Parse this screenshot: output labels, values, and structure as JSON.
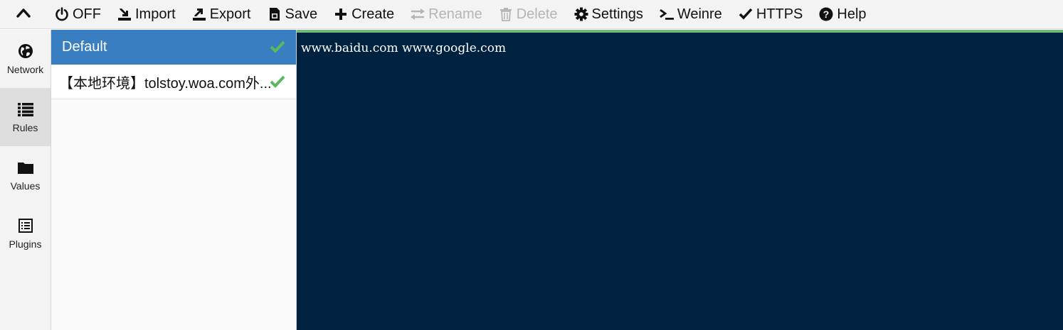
{
  "toolbar": {
    "toggle_icon": "chevron-up-icon",
    "buttons": [
      {
        "label": "OFF",
        "icon": "power-icon",
        "disabled": false
      },
      {
        "label": "Import",
        "icon": "import-icon",
        "disabled": false
      },
      {
        "label": "Export",
        "icon": "export-icon",
        "disabled": false
      },
      {
        "label": "Save",
        "icon": "save-icon",
        "disabled": false
      },
      {
        "label": "Create",
        "icon": "plus-icon",
        "disabled": false
      },
      {
        "label": "Rename",
        "icon": "rename-icon",
        "disabled": true
      },
      {
        "label": "Delete",
        "icon": "trash-icon",
        "disabled": true
      },
      {
        "label": "Settings",
        "icon": "gear-icon",
        "disabled": false
      },
      {
        "label": "Weinre",
        "icon": "terminal-icon",
        "disabled": false
      },
      {
        "label": "HTTPS",
        "icon": "check-icon",
        "disabled": false
      },
      {
        "label": "Help",
        "icon": "question-icon",
        "disabled": false
      }
    ]
  },
  "sidenav": {
    "items": [
      {
        "label": "Network",
        "icon": "globe-icon",
        "active": false
      },
      {
        "label": "Rules",
        "icon": "list-icon",
        "active": true
      },
      {
        "label": "Values",
        "icon": "folder-icon",
        "active": false
      },
      {
        "label": "Plugins",
        "icon": "plugin-icon",
        "active": false
      }
    ]
  },
  "rules": {
    "items": [
      {
        "name": "Default",
        "selected": true,
        "enabled": true
      },
      {
        "name": "【本地环境】tolstoy.woa.com外...",
        "selected": false,
        "enabled": true
      }
    ]
  },
  "editor": {
    "content": "www.baidu.com www.google.com"
  },
  "colors": {
    "selected_bg": "#3a7ec2",
    "check_green": "#5cb85c",
    "editor_bg": "#002241",
    "editor_top_border": "#6fba7d",
    "disabled_text": "#b5b5b5"
  }
}
